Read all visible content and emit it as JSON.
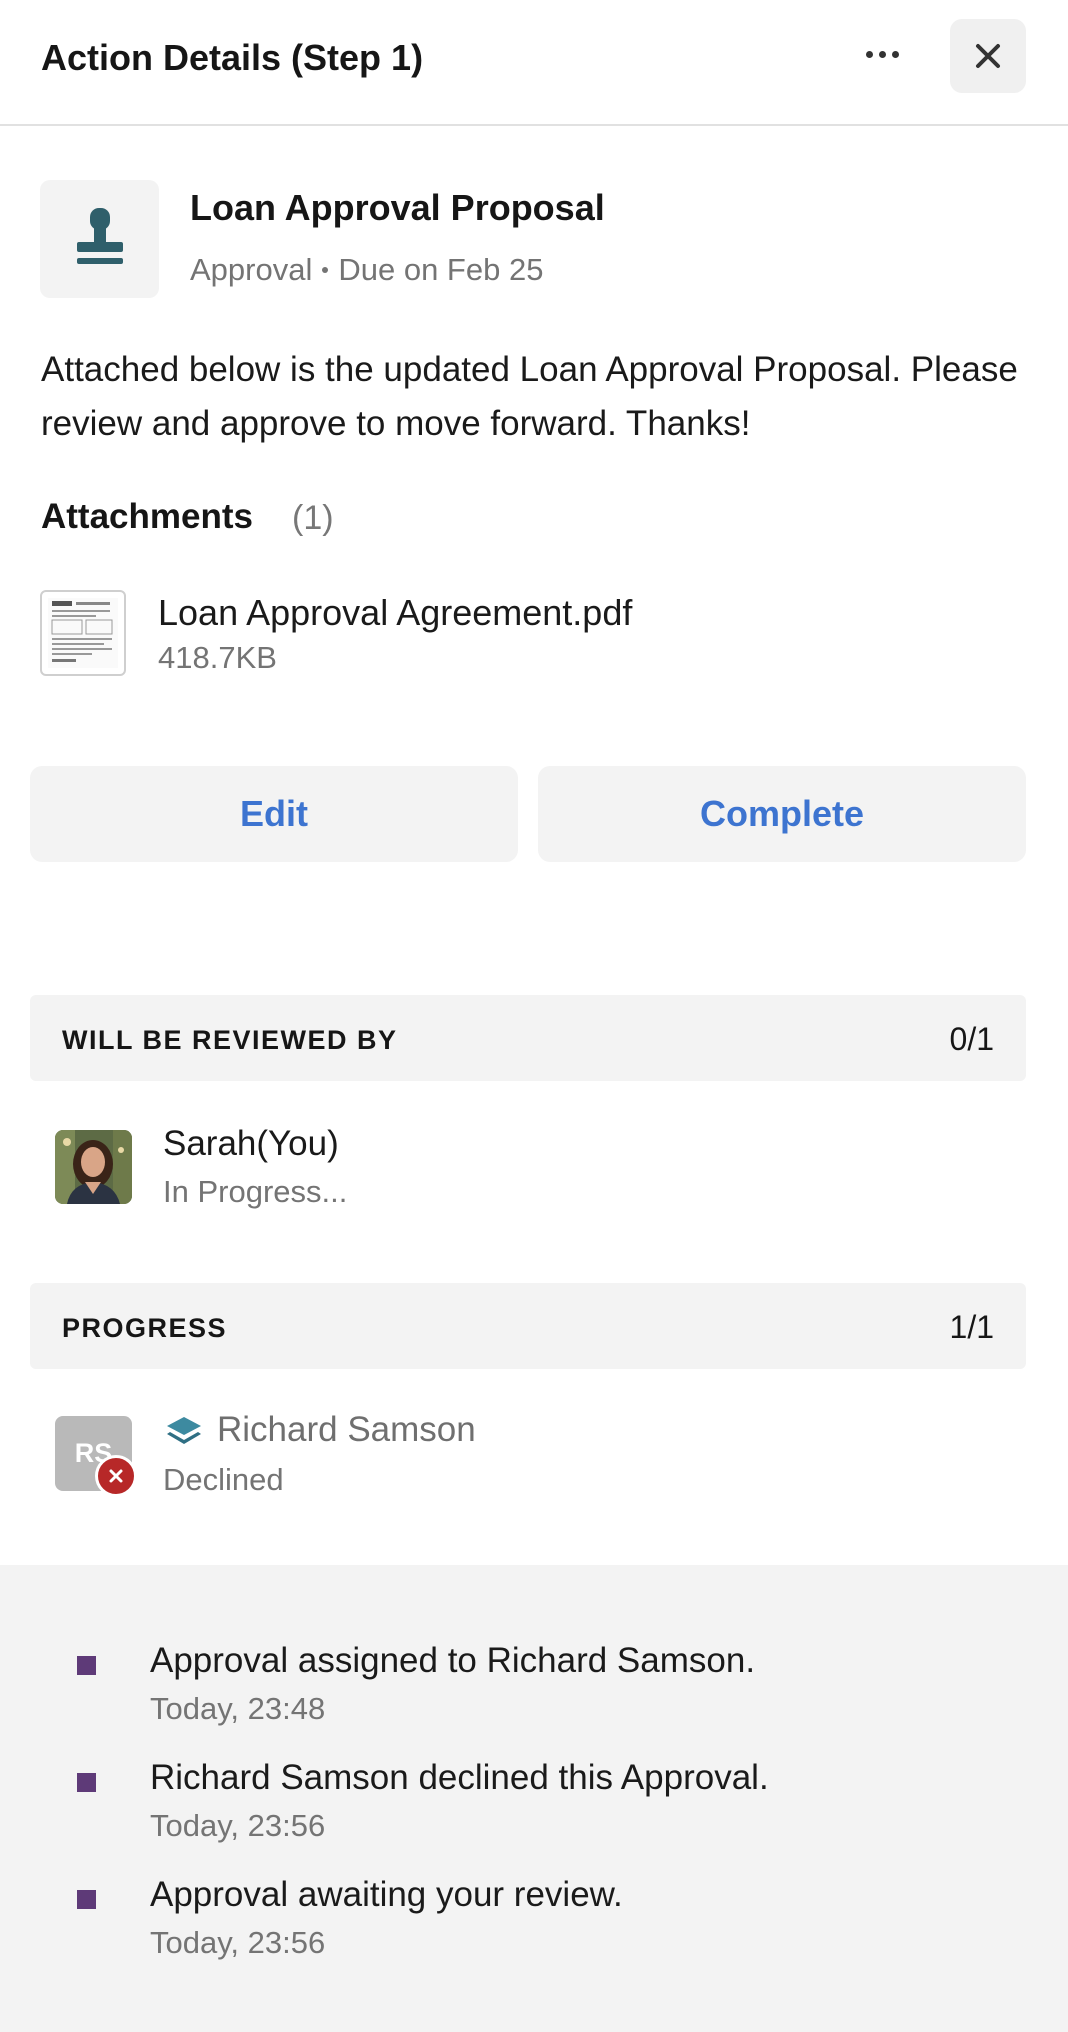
{
  "header": {
    "title": "Action Details (Step 1)",
    "more_icon": "more-horizontal-icon",
    "close_icon": "close-icon"
  },
  "task": {
    "icon": "stamp-icon",
    "title": "Loan Approval Proposal",
    "type": "Approval",
    "due": "Due on Feb 25",
    "description": "Attached below is the updated Loan Approval Proposal. Please review and approve to move forward. Thanks!"
  },
  "attachments": {
    "heading": "Attachments",
    "count": "(1)",
    "files": [
      {
        "name": "Loan Approval Agreement.pdf",
        "size": "418.7KB"
      }
    ]
  },
  "actions": {
    "edit_label": "Edit",
    "complete_label": "Complete",
    "accent_color": "#3d74d0"
  },
  "reviewers": {
    "label": "WILL BE REVIEWED BY",
    "count": "0/1",
    "items": [
      {
        "name": "Sarah(You)",
        "status": "In Progress..."
      }
    ]
  },
  "progress": {
    "label": "PROGRESS",
    "count": "1/1",
    "items": [
      {
        "initials": "RS",
        "name": "Richard Samson",
        "status": "Declined",
        "badge_color": "#b72828"
      }
    ]
  },
  "activity": {
    "bullet_color": "#5e3a78",
    "items": [
      {
        "text": "Approval assigned to Richard Samson.",
        "time": "Today, 23:48"
      },
      {
        "text": "Richard Samson declined this Approval.",
        "time": "Today, 23:56"
      },
      {
        "text": "Approval awaiting your review.",
        "time": "Today, 23:56"
      }
    ]
  }
}
